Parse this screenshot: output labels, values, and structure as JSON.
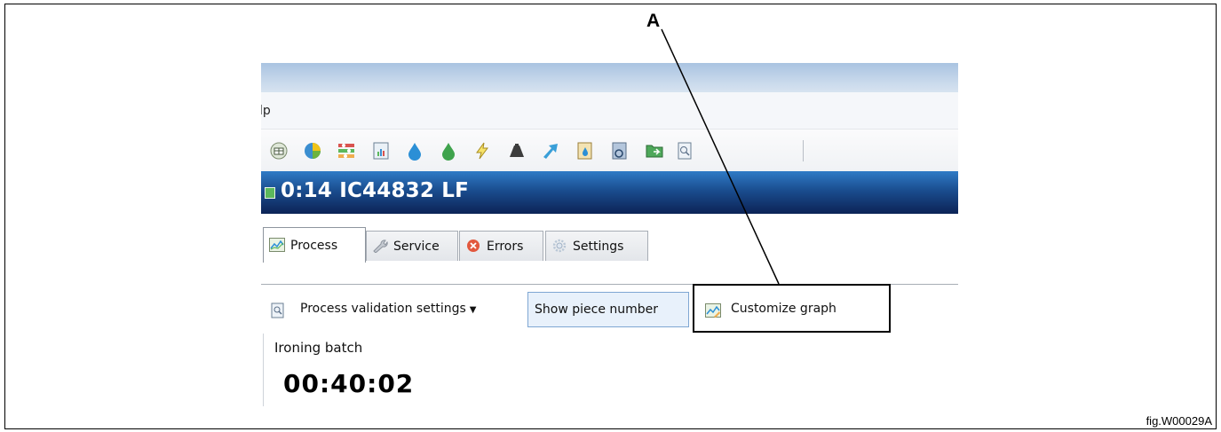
{
  "callout": {
    "letter": "A"
  },
  "figure_label": "fig.W00029A",
  "menu": {
    "partial_item": "lp"
  },
  "toolbar": {
    "icons": [
      "grid-icon",
      "pie-chart-icon",
      "bar-chart-icon",
      "calculator-icon",
      "water-drop-blue-icon",
      "water-drop-green-icon",
      "lightning-icon",
      "weight-icon",
      "arrow-icon",
      "document-drop-icon",
      "document-refresh-icon",
      "folder-icon",
      "report-icon"
    ]
  },
  "header": {
    "title": "0:14 IC44832 LF"
  },
  "tabs": [
    {
      "label": "Process",
      "icon": "chart-icon",
      "active": true
    },
    {
      "label": "Service",
      "icon": "wrench-icon",
      "active": false
    },
    {
      "label": "Errors",
      "icon": "error-icon",
      "active": false
    },
    {
      "label": "Settings",
      "icon": "gear-icon",
      "active": false
    }
  ],
  "actions": {
    "process_validation": "Process validation settings",
    "show_piece_number": "Show piece number",
    "customize_graph": "Customize graph"
  },
  "batch": {
    "label": "Ironing batch",
    "timer": "00:40:02"
  }
}
